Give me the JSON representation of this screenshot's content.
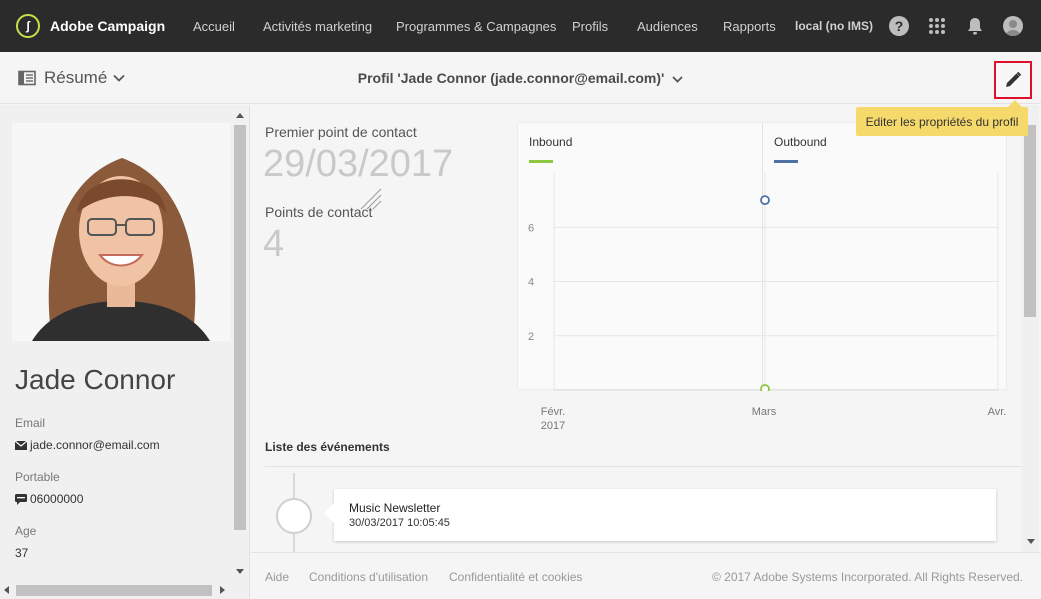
{
  "app": {
    "name": "Adobe Campaign",
    "logo_letter": "ʃ",
    "instance": "local (no IMS)"
  },
  "nav": {
    "items": [
      "Accueil",
      "Activités marketing",
      "Programmes & Campagnes",
      "Profils",
      "Audiences",
      "Rapports"
    ]
  },
  "topbar_icons": {
    "help": "?",
    "apps": "grid-icon",
    "notifications": "bell-icon",
    "user": "user-avatar-icon"
  },
  "header": {
    "summary_label": "Résumé",
    "profile_title": "Profil 'Jade Connor (jade.connor@email.com)'",
    "edit_icon": "pencil-icon",
    "edit_tooltip": "Editer les propriétés du profil"
  },
  "profile": {
    "name": "Jade Connor",
    "fields": [
      {
        "label": "Email",
        "value": "jade.connor@email.com",
        "icon": "envelope-icon"
      },
      {
        "label": "Portable",
        "value": "06000000",
        "icon": "sms-icon"
      },
      {
        "label": "Age",
        "value": "37",
        "icon": ""
      }
    ]
  },
  "stats": {
    "first_contact_label": "Premier point de contact",
    "first_contact_value": "29/03/2017",
    "contact_points_label": "Points de contact",
    "contact_points_value": "4"
  },
  "chart_data": {
    "type": "line",
    "legend": [
      {
        "name": "Inbound",
        "color": "#8dc63f"
      },
      {
        "name": "Outbound",
        "color": "#4f6fa7"
      }
    ],
    "x_categories": [
      "Févr.\n2017",
      "Mars",
      "Avr."
    ],
    "y_ticks": [
      2,
      4,
      6
    ],
    "ylim": [
      0,
      8
    ],
    "series": [
      {
        "name": "Inbound",
        "points": [
          {
            "x": "Mars",
            "y": 0
          }
        ]
      },
      {
        "name": "Outbound",
        "points": [
          {
            "x": "Mars",
            "y": 7
          }
        ]
      }
    ],
    "grid": true
  },
  "events": {
    "title": "Liste des événements",
    "items": [
      {
        "name": "Music Newsletter",
        "date": "30/03/2017 10:05:45"
      }
    ]
  },
  "footer": {
    "links": [
      "Aide",
      "Conditions d'utilisation",
      "Confidentialité et cookies"
    ],
    "copyright": "© 2017 Adobe Systems Incorporated. All Rights Reserved."
  },
  "colors": {
    "topbar": "#2b2b2b",
    "accent_highlight": "#e0102a",
    "tooltip": "#f6d96b",
    "inbound": "#8dc63f",
    "outbound": "#4f6fa7"
  }
}
